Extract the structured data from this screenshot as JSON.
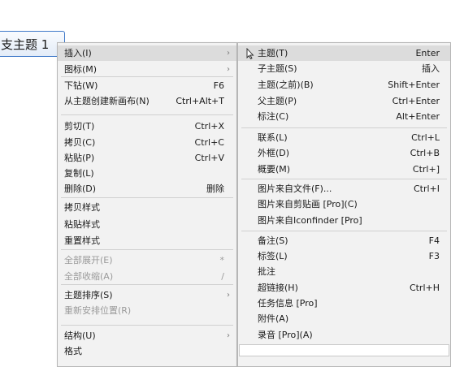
{
  "topic": {
    "label": "支主题 1"
  },
  "menu1": [
    {
      "label": "插入(I)",
      "shortcut": "",
      "submenu": true,
      "disabled": false,
      "highlight": true
    },
    {
      "label": "图标(M)",
      "shortcut": "",
      "submenu": true,
      "disabled": false
    },
    {
      "sep": true
    },
    {
      "label": "下钻(W)",
      "shortcut": "F6",
      "disabled": false
    },
    {
      "label": "从主题创建新画布(N)",
      "shortcut": "Ctrl+Alt+T",
      "disabled": false
    },
    {
      "sep": true
    },
    {
      "label": "剪切(T)",
      "shortcut": "Ctrl+X",
      "disabled": false
    },
    {
      "label": "拷贝(C)",
      "shortcut": "Ctrl+C",
      "disabled": false
    },
    {
      "label": "粘贴(P)",
      "shortcut": "Ctrl+V",
      "disabled": false
    },
    {
      "label": "复制(L)",
      "shortcut": "",
      "disabled": false
    },
    {
      "label": "删除(D)",
      "shortcut": "删除",
      "disabled": false
    },
    {
      "sep": true
    },
    {
      "label": "拷贝样式",
      "shortcut": "",
      "disabled": false
    },
    {
      "label": "粘贴样式",
      "shortcut": "",
      "disabled": false
    },
    {
      "label": "重置样式",
      "shortcut": "",
      "disabled": false
    },
    {
      "sep": true
    },
    {
      "label": "全部展开(E)",
      "shortcut": "*",
      "disabled": true
    },
    {
      "label": "全部收缩(A)",
      "shortcut": "/",
      "disabled": true
    },
    {
      "sep": true
    },
    {
      "label": "主题排序(S)",
      "shortcut": "",
      "submenu": true,
      "disabled": false
    },
    {
      "label": "重新安排位置(R)",
      "shortcut": "",
      "disabled": true
    },
    {
      "sep": true
    },
    {
      "label": "结构(U)",
      "shortcut": "",
      "submenu": true,
      "disabled": false
    },
    {
      "label": "格式",
      "shortcut": "",
      "disabled": false
    }
  ],
  "menu2": [
    {
      "label": "主题(T)",
      "shortcut": "Enter",
      "highlight": true
    },
    {
      "label": "子主题(S)",
      "shortcut": "插入"
    },
    {
      "label": "主题(之前)(B)",
      "shortcut": "Shift+Enter"
    },
    {
      "label": "父主题(P)",
      "shortcut": "Ctrl+Enter"
    },
    {
      "label": "标注(C)",
      "shortcut": "Alt+Enter"
    },
    {
      "sep": true
    },
    {
      "label": "联系(L)",
      "shortcut": "Ctrl+L"
    },
    {
      "label": "外框(D)",
      "shortcut": "Ctrl+B"
    },
    {
      "label": "概要(M)",
      "shortcut": "Ctrl+]"
    },
    {
      "sep": true
    },
    {
      "label": "图片来自文件(F)...",
      "shortcut": "Ctrl+I"
    },
    {
      "label": "图片来自剪贴画 [Pro](C)",
      "shortcut": ""
    },
    {
      "label": "图片来自Iconfinder [Pro]",
      "shortcut": ""
    },
    {
      "sep": true
    },
    {
      "label": "备注(S)",
      "shortcut": "F4"
    },
    {
      "label": "标签(L)",
      "shortcut": "F3"
    },
    {
      "label": "批注",
      "shortcut": ""
    },
    {
      "label": "超链接(H)",
      "shortcut": "Ctrl+H"
    },
    {
      "label": "任务信息 [Pro]",
      "shortcut": ""
    },
    {
      "label": "附件(A)",
      "shortcut": ""
    },
    {
      "label": "录音 [Pro](A)",
      "shortcut": ""
    }
  ]
}
